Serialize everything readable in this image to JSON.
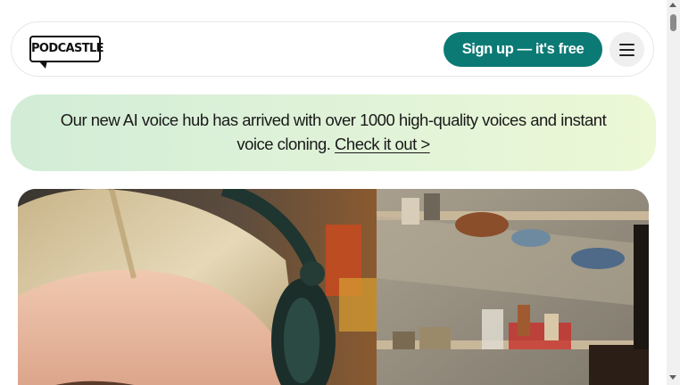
{
  "header": {
    "logo_text": "PODCASTLE",
    "signup_label": "Sign up — it's free",
    "menu_icon": "hamburger-menu-icon"
  },
  "banner": {
    "text": "Our new AI voice hub has arrived with over 1000 high-quality voices and instant voice cloning.",
    "link_label": "Check it out >"
  },
  "hero": {
    "image": "person-with-headphones-photo"
  },
  "colors": {
    "primary_button": "#0b7a75",
    "banner_gradient_start": "#d2ecd6",
    "banner_gradient_end": "#ecf8d6"
  }
}
